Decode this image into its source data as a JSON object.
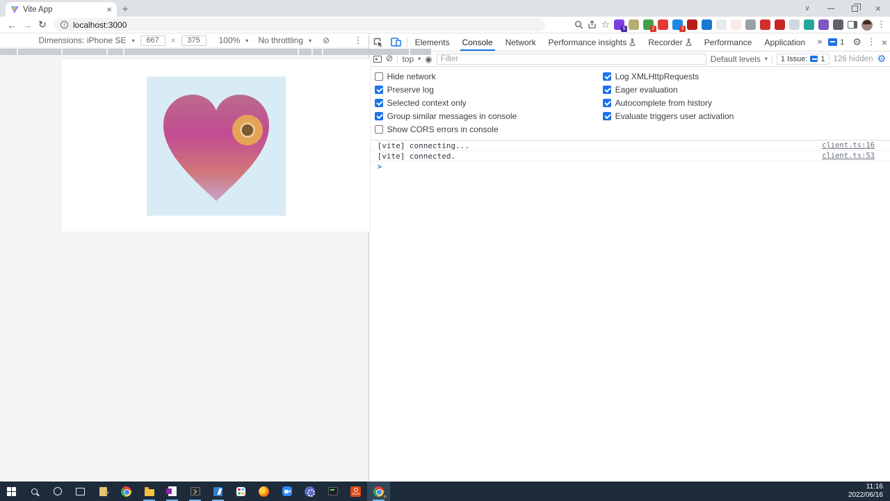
{
  "colors": {
    "accent": "#1a73e8",
    "taskbar_bg": "#1d2b3a",
    "square_bg": "#d9ecf5",
    "heart_top": "#bb6b8a",
    "heart_mid": "#c24b92",
    "heart_low": "#d07579",
    "heart_tip": "#c7a5ca",
    "knot_outer": "#e4a458",
    "knot_ring": "#eed3a0",
    "knot_inner": "#7c5a33"
  },
  "glyphs": {
    "close": "×",
    "plus": "+",
    "kebab": "⋮",
    "caret": "▾",
    "back": "←",
    "forward": "→",
    "reload": "↻",
    "times": "×",
    "clear": "⊘",
    "more": "»",
    "prompt": ">",
    "star": "☆",
    "gear": "⚙",
    "eye": "◉",
    "info": "i",
    "rotate": "⊘",
    "chevron_down": "∨",
    "minimize": "–"
  },
  "browser": {
    "tab_title": "Vite App",
    "url": "localhost:3000"
  },
  "device_toolbar": {
    "label": "Dimensions: iPhone SE",
    "width": "667",
    "height": "375",
    "zoom": "100%",
    "throttling": "No throttling"
  },
  "extensions": [
    {
      "name": "ext-purple-shapes",
      "color": "#7b3fe4",
      "badge": "5",
      "badge_color": "#4527a0"
    },
    {
      "name": "ext-olive-drop",
      "color": "#b8ae72"
    },
    {
      "name": "ext-green-translate",
      "color": "#43a047",
      "badge": "2",
      "badge_color": "#d93025"
    },
    {
      "name": "ext-red-lock",
      "color": "#e53935"
    },
    {
      "name": "ext-blue-drop",
      "color": "#1e88e5",
      "badge": "3",
      "badge_color": "#d93025"
    },
    {
      "name": "ext-darkred-grid",
      "color": "#b71c1c"
    },
    {
      "name": "ext-blue-download",
      "color": "#1976d2"
    },
    {
      "name": "ext-cloud",
      "color": "#e8eaed"
    },
    {
      "name": "ext-pocket",
      "color": "#fbe9e7"
    },
    {
      "name": "ext-gray-arrow",
      "color": "#9aa0a6"
    },
    {
      "name": "ext-red-h",
      "color": "#d32f2f"
    },
    {
      "name": "ext-red-photo",
      "color": "#c62828"
    },
    {
      "name": "ext-gray-wheel",
      "color": "#cfd8dc"
    },
    {
      "name": "ext-teal-pen",
      "color": "#26a69a"
    },
    {
      "name": "ext-violet-flower",
      "color": "#7e57c2"
    },
    {
      "name": "ext-puzzle",
      "color": "#5f6368"
    }
  ],
  "devtools": {
    "tabs": [
      {
        "label": "Elements",
        "active": false
      },
      {
        "label": "Console",
        "active": true
      },
      {
        "label": "Network",
        "active": false
      },
      {
        "label": "Performance insights",
        "active": false,
        "flask": true
      },
      {
        "label": "Recorder",
        "active": false,
        "flask": true
      },
      {
        "label": "Performance",
        "active": false
      },
      {
        "label": "Application",
        "active": false
      }
    ],
    "issues_badge": "1",
    "toolbar": {
      "context": "top",
      "filter_placeholder": "Filter",
      "levels": "Default levels",
      "issue_label": "1 Issue:",
      "issue_count": "1",
      "hidden": "126 hidden"
    },
    "settings_left": [
      {
        "label": "Hide network",
        "checked": false
      },
      {
        "label": "Preserve log",
        "checked": true
      },
      {
        "label": "Selected context only",
        "checked": true
      },
      {
        "label": "Group similar messages in console",
        "checked": true
      },
      {
        "label": "Show CORS errors in console",
        "checked": false
      }
    ],
    "settings_right": [
      {
        "label": "Log XMLHttpRequests",
        "checked": true
      },
      {
        "label": "Eager evaluation",
        "checked": true
      },
      {
        "label": "Autocomplete from history",
        "checked": true
      },
      {
        "label": "Evaluate triggers user activation",
        "checked": true
      }
    ],
    "messages": [
      {
        "text": "[vite] connecting...",
        "source": "client.ts:16"
      },
      {
        "text": "[vite] connected.",
        "source": "client.ts:53"
      }
    ]
  },
  "taskbar": {
    "time": "11:16",
    "date": "2022/06/16",
    "ubuntu_label": "20.04",
    "icons": [
      {
        "name": "start",
        "running": false
      },
      {
        "name": "search",
        "running": false
      },
      {
        "name": "cortana",
        "running": false
      },
      {
        "name": "task-view",
        "running": false
      },
      {
        "name": "document-viewer",
        "running": false
      },
      {
        "name": "chrome",
        "running": false
      },
      {
        "name": "file-explorer",
        "running": true
      },
      {
        "name": "word",
        "running": true
      },
      {
        "name": "terminal",
        "running": true
      },
      {
        "name": "vscode",
        "running": true
      },
      {
        "name": "app-grid",
        "running": false
      },
      {
        "name": "firefox",
        "running": false
      },
      {
        "name": "zoom",
        "running": false
      },
      {
        "name": "settings",
        "running": false
      },
      {
        "name": "console",
        "running": false
      },
      {
        "name": "ubuntu",
        "running": false
      },
      {
        "name": "chrome-active",
        "running": true,
        "active": true
      }
    ]
  }
}
